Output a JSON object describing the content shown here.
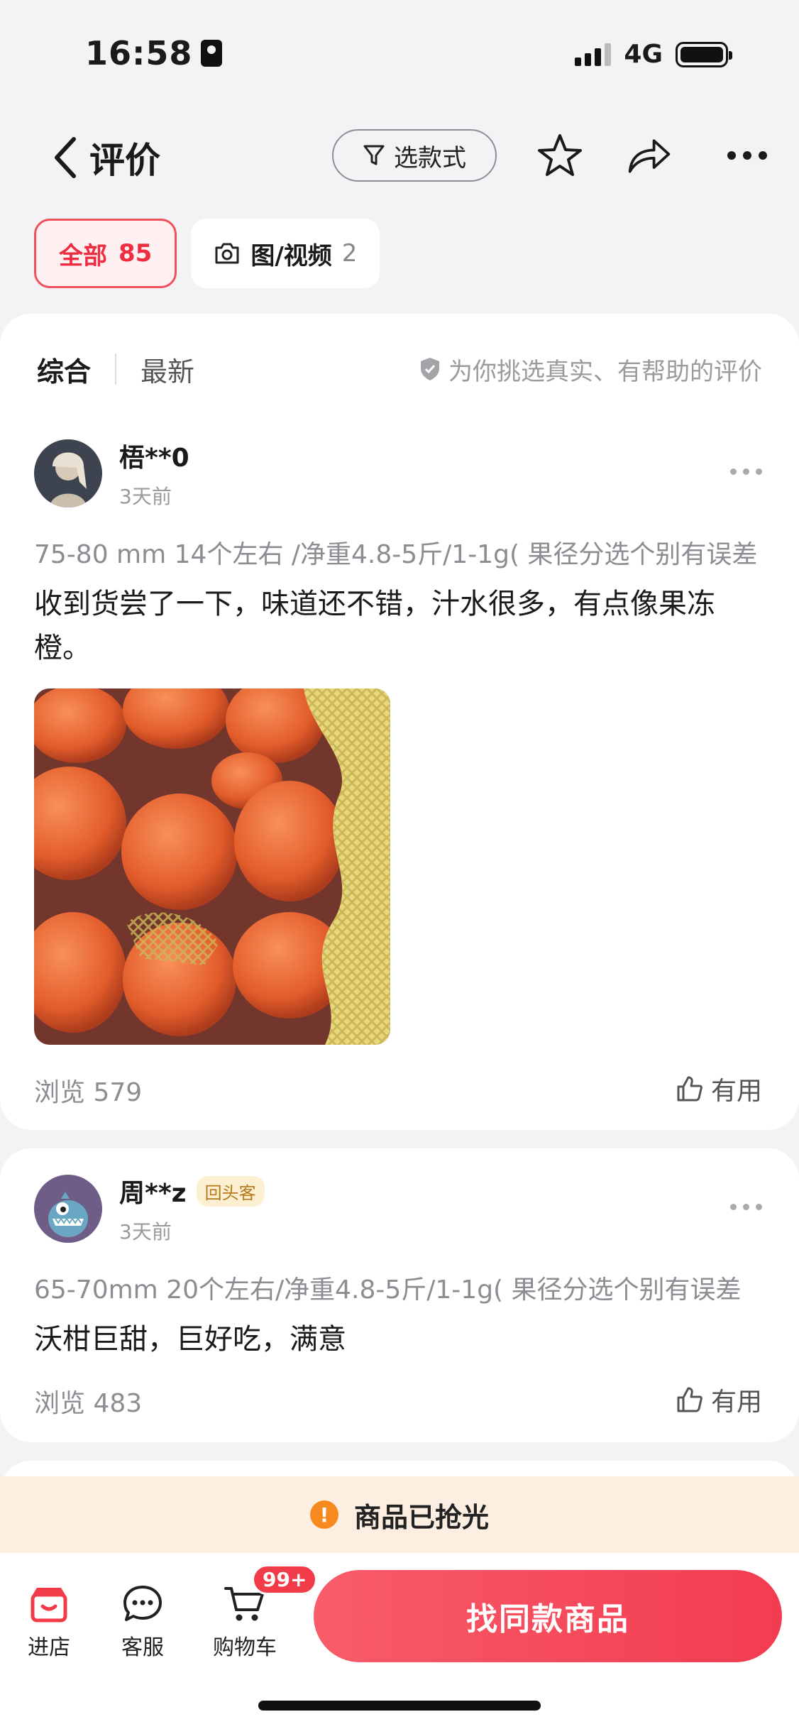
{
  "status": {
    "time": "16:58",
    "network": "4G"
  },
  "nav": {
    "title": "评价",
    "style_button": "选款式"
  },
  "filters": [
    {
      "label": "全部",
      "count": "85"
    },
    {
      "label": "图/视频",
      "count": "2"
    }
  ],
  "sort": {
    "tabs": [
      "综合",
      "最新"
    ],
    "note": "为你挑选真实、有帮助的评价"
  },
  "reviews": [
    {
      "username": "梧**0",
      "time": "3天前",
      "spec": "75-80 mm 14个左右          /净重4.8-5斤/1-1g( 果径分选个别有误差",
      "content": "收到货尝了一下，味道还不错，汁水很多，有点像果冻橙。",
      "views": "浏览 579",
      "useful": "有用"
    },
    {
      "username": "周**z",
      "badge": "回头客",
      "time": "3天前",
      "spec": "65-70mm  20个左右/净重4.8-5斤/1-1g( 果径分选个别有误差",
      "content": "沃柑巨甜，巨好吃，满意",
      "views": "浏览 483",
      "useful": "有用"
    }
  ],
  "banner": {
    "text": "商品已抢光"
  },
  "bottom": {
    "tabs": [
      "进店",
      "客服",
      "购物车"
    ],
    "cart_badge": "99+",
    "cta": "找同款商品"
  },
  "colors": {
    "accent": "#f23b49",
    "warning": "#f68a1f"
  }
}
